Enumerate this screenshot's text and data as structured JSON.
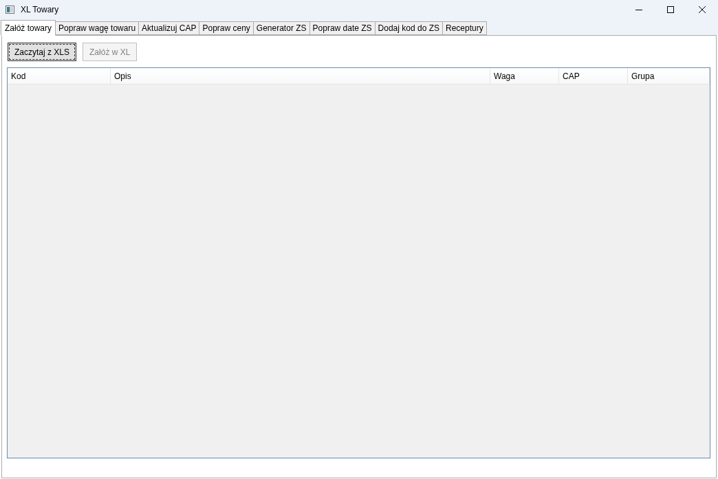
{
  "window": {
    "title": "XL Towary"
  },
  "tabs": [
    {
      "label": "Załóż towary",
      "selected": true
    },
    {
      "label": "Popraw wagę towaru",
      "selected": false
    },
    {
      "label": "Aktualizuj CAP",
      "selected": false
    },
    {
      "label": "Popraw ceny",
      "selected": false
    },
    {
      "label": "Generator ZS",
      "selected": false
    },
    {
      "label": "Popraw date ZS",
      "selected": false
    },
    {
      "label": "Dodaj kod do ZS",
      "selected": false
    },
    {
      "label": "Receptury",
      "selected": false
    }
  ],
  "buttons": [
    {
      "label": "Zaczytaj z XLS",
      "disabled": false,
      "focused": true
    },
    {
      "label": "Załóż w XL",
      "disabled": true,
      "focused": false
    }
  ],
  "table": {
    "columns": [
      "Kod",
      "Opis",
      "Waga",
      "CAP",
      "Grupa"
    ]
  }
}
